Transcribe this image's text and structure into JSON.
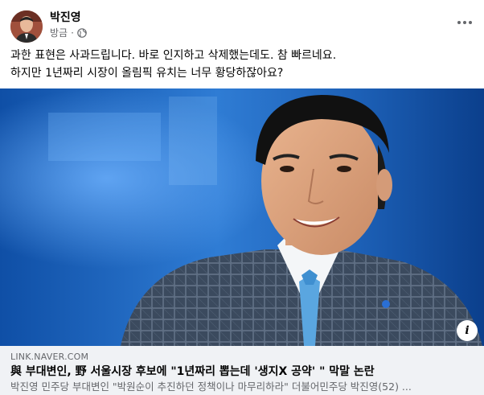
{
  "post": {
    "author": "박진영",
    "time": "방금",
    "separator": "·",
    "privacy_icon": "globe-icon",
    "more_icon": "more-options-icon",
    "text_lines": [
      "과한 표현은 사과드립니다. 바로 인지하고 삭제했는데도. 참 빠르네요.",
      "하지만 1년짜리 시장이 올림픽 유치는 너무 황당하잖아요?"
    ]
  },
  "link_preview": {
    "domain": "LINK.NAVER.COM",
    "title": "與 부대변인, 野 서울시장 후보에 \"1년짜리 뽑는데 '생지X 공약' \" 막말 논란",
    "description": "박진영 민주당 부대변인 \"박원순이 추진하던 정책이나 마무리하라\" 더불어민주당 박진영(52) ...",
    "info_label": "i"
  },
  "colors": {
    "text_primary": "#050505",
    "text_secondary": "#65676b",
    "card_background": "#f0f2f5",
    "photo_background": "#1a56a8"
  }
}
